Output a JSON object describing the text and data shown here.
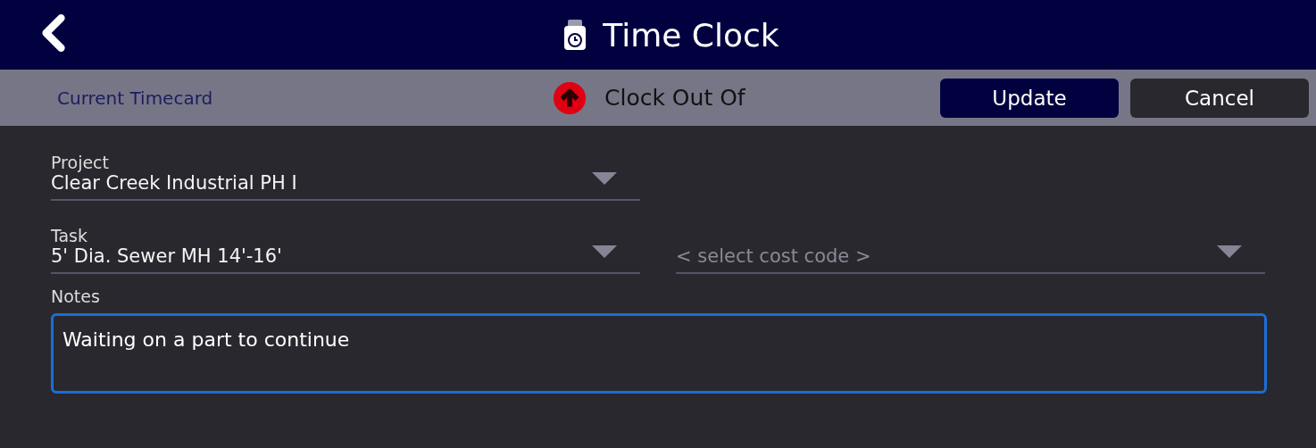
{
  "header": {
    "title": "Time Clock"
  },
  "toolbar": {
    "section_label": "Current Timecard",
    "action": "Clock Out Of",
    "buttons": [
      {
        "label": "Update",
        "kind": "primary"
      },
      {
        "label": "Cancel",
        "kind": "secondary"
      }
    ]
  },
  "rows": [
    {
      "fields": [
        {
          "label": "Project",
          "value": "Clear Creek Industrial PH I"
        }
      ]
    },
    {
      "fields": [
        {
          "label": "Task",
          "value": "5' Dia. Sewer MH 14'-16'"
        },
        {
          "placeholder": "< select cost code >"
        }
      ]
    }
  ],
  "notes": {
    "label": "Notes",
    "value": "Waiting on a part to continue"
  }
}
